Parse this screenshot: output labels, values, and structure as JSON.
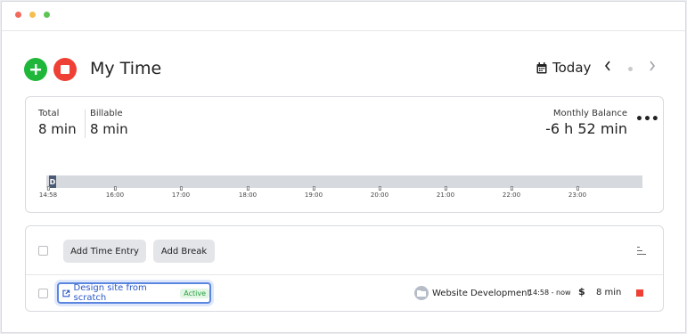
{
  "window": {
    "controls": [
      {
        "name": "close",
        "color": "#ef6b5e"
      },
      {
        "name": "minimize",
        "color": "#f5bf4f"
      },
      {
        "name": "maximize",
        "color": "#5fc454"
      }
    ]
  },
  "header": {
    "title": "My Time",
    "date_label": "Today",
    "add_icon": "plus-icon",
    "stop_icon": "stop-icon"
  },
  "summary": {
    "total_label": "Total",
    "total_value": "8 min",
    "billable_label": "Billable",
    "billable_value": "8 min",
    "balance_label": "Monthly Balance",
    "balance_value": "-6 h 52 min",
    "more_label": "•••",
    "timeline": {
      "marker_label": "D",
      "ticks": [
        "14:58",
        "16:00",
        "17:00",
        "18:00",
        "19:00",
        "20:00",
        "21:00",
        "22:00",
        "23:00"
      ]
    }
  },
  "entries": {
    "add_time_entry_label": "Add Time Entry",
    "add_break_label": "Add Break",
    "rows": [
      {
        "task": "Design site from scratch",
        "status": "Active",
        "project": "Website Development",
        "time_range": "14:58 - now",
        "billable_symbol": "$",
        "duration": "8 min"
      }
    ]
  },
  "colors": {
    "add_green": "#1fb73a",
    "stop_red": "#ef4035",
    "link_blue": "#2a57c6",
    "active_green": "#25a13b"
  }
}
